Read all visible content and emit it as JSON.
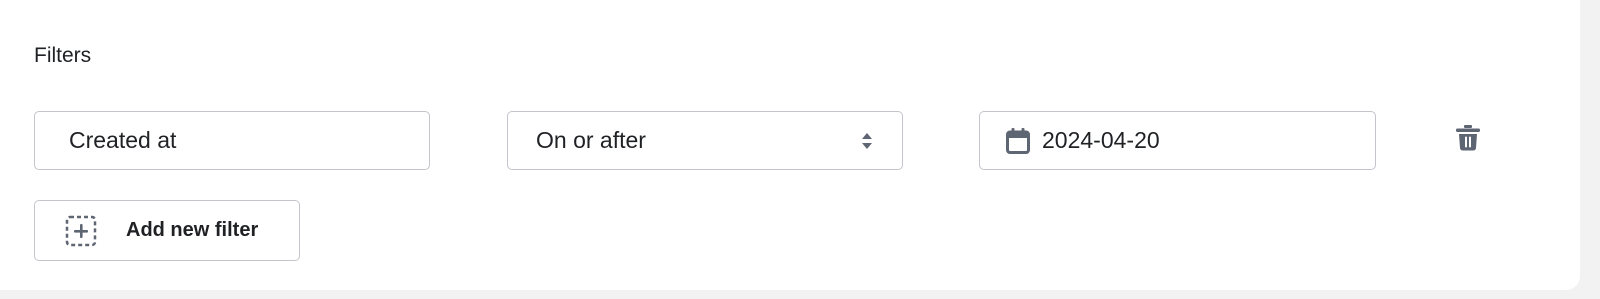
{
  "filters": {
    "title": "Filters",
    "row": {
      "field_value": "Created at",
      "operator_value": "On or after",
      "date_value": "2024-04-20"
    },
    "add_label": "Add new filter"
  },
  "icons": {
    "sort": "sort-arrows-icon",
    "calendar": "calendar-icon",
    "trash": "trash-icon",
    "add": "dashed-plus-square-icon"
  },
  "colors": {
    "text": "#1f2124",
    "border": "#c3c5cb",
    "icon": "#5f6673"
  }
}
